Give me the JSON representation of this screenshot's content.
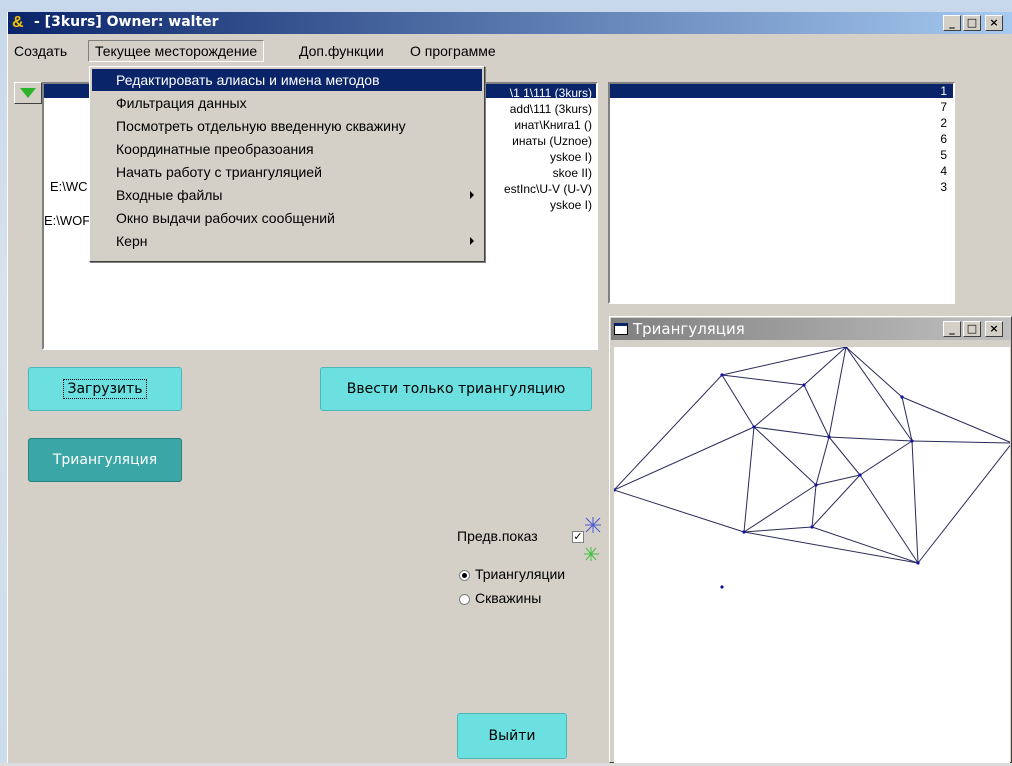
{
  "window": {
    "title": "- [3kurs] Owner: walter",
    "icon": "app-icon",
    "controls": {
      "minimize": "_",
      "maximize": "□",
      "close": "×"
    }
  },
  "menubar": {
    "items": [
      {
        "label": "Создать"
      },
      {
        "label": "Текущее месторождение"
      },
      {
        "label": "Доп.функции"
      },
      {
        "label": "О программе"
      }
    ]
  },
  "dropdown": {
    "items": [
      {
        "label": "Редактировать алиасы и имена методов",
        "submenu": false
      },
      {
        "label": "Фильтрация данных",
        "submenu": false
      },
      {
        "label": "Посмотреть отдельную введенную скважину",
        "submenu": false
      },
      {
        "label": "Координатные преобразоания",
        "submenu": false
      },
      {
        "label": "Начать работу с триангуляцией",
        "submenu": false
      },
      {
        "label": "Входные файлы",
        "submenu": true
      },
      {
        "label": "Окно выдачи рабочих сообщений",
        "submenu": false
      },
      {
        "label": "Керн",
        "submenu": true
      }
    ]
  },
  "project_list": {
    "left_fragments": [
      "E:\\WC",
      "E:\\WOF"
    ],
    "right_fragments": [
      "\\1 1\\111  (3kurs)",
      "add\\111  (3kurs)",
      "инат\\Книга1  ()",
      "инаты  (Uznoe)",
      "yskoe         I)",
      "skoe          II)",
      "estInc\\U-V  (U-V)",
      "yskoe         I)"
    ]
  },
  "number_list": {
    "items": [
      "1",
      "7",
      "2",
      "6",
      "5",
      "4",
      "3"
    ]
  },
  "buttons": {
    "load": "Загрузить",
    "input_triangulation": "Ввести только триангуляцию",
    "triangulation": "Триангуляция",
    "exit": "Выйти"
  },
  "preview": {
    "label": "Предв.показ",
    "checked": "✓",
    "radio_triangulation": "Триангуляции",
    "radio_wells": "Скважины"
  },
  "child_window": {
    "title": "Триангуляция",
    "controls": {
      "minimize": "_",
      "maximize": "□",
      "close": "×"
    }
  },
  "colors": {
    "selection": "#0a246a",
    "button_light": "#6ce0e0",
    "button_dark": "#3aa6a6",
    "edge": "#2a2a5a",
    "vertex": "#1010a0"
  }
}
